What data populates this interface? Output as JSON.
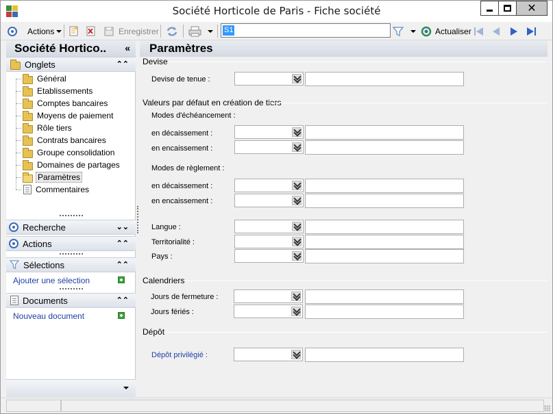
{
  "window": {
    "title": "Société Horticole de Paris  -  Fiche société",
    "close_glyph": "✕"
  },
  "toolbar": {
    "actions_label": "Actions",
    "save_label": "Enregistrer",
    "search_value": "S1",
    "refresh_label": "Actualiser"
  },
  "left_panel": {
    "title": "Société Hortico..",
    "collapse_glyph": "«",
    "onglets_label": "Onglets",
    "tabs": [
      "Général",
      "Etablissements",
      "Comptes bancaires",
      "Moyens de paiement",
      "Rôle tiers",
      "Contrats bancaires",
      "Groupe consolidation",
      "Domaines de partages",
      "Paramètres",
      "Commentaires"
    ],
    "selected_tab": "Paramètres",
    "recherche_label": "Recherche",
    "actions_label": "Actions",
    "selections_label": "Sélections",
    "add_selection_label": "Ajouter une sélection",
    "documents_label": "Documents",
    "new_document_label": "Nouveau document"
  },
  "main": {
    "title": "Paramètres",
    "devise_group": "Devise",
    "devise_tenue_label": "Devise de tenue :",
    "valeurs_group": "Valeurs par défaut en création de tiers",
    "modes_echeancement_label": "Modes d'échéancement :",
    "modes_reglement_label": "Modes de règlement :",
    "decaissement_label": "en décaissement :",
    "encaissement_label": "en encaissement :",
    "langue_label": "Langue :",
    "territorialite_label": "Territorialité :",
    "pays_label": "Pays :",
    "calendriers_group": "Calendriers",
    "jours_fermeture_label": "Jours de fermeture :",
    "jours_feries_label": "Jours fériés :",
    "depot_group": "Dépôt",
    "depot_privilegie_label": "Dépôt privilégié  :"
  },
  "colors": {
    "accent_blue": "#3d6bb3",
    "link_blue": "#1f3ea6",
    "folder_yellow": "#e6c154",
    "selection_blue": "#3399ff"
  }
}
